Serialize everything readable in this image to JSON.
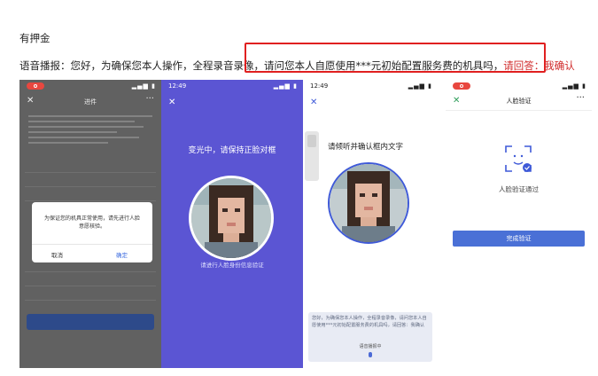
{
  "heading": "有押金",
  "voice": {
    "prefix": "语音播报：您好，为确保您本人操作，全程录音录像，",
    "question": "请问您本人自愿使用***元初始配置服务费的机具吗，",
    "answer": "请回答：我确认"
  },
  "phone1": {
    "title": "进件",
    "close_icon": "close-icon",
    "more_icon": "more-icon",
    "dialog": {
      "message": "为保证您的机具正常使用，请先进行人脸意愿核验。",
      "cancel": "取消",
      "confirm": "确定"
    }
  },
  "phone2": {
    "time": "12:49",
    "title": "变光中，请保持正脸对框",
    "subtitle": "请进行人脸身份信息验证"
  },
  "phone3": {
    "time": "12:49",
    "title": "请倾听并确认框内文字",
    "panel_text": "您好，为确保您本人操作，全程录音录像，请问您本人自愿使用***元初始配置服务费的机具吗，请回答：我确认",
    "prompt": "语音播报中"
  },
  "phone4": {
    "title": "人脸验证",
    "result": "人脸验证通过",
    "done_button": "完成验证"
  },
  "colors": {
    "highlight_red": "#d02b2b",
    "accent_blue": "#4a70d6",
    "purple_bg": "#5b55d3"
  }
}
